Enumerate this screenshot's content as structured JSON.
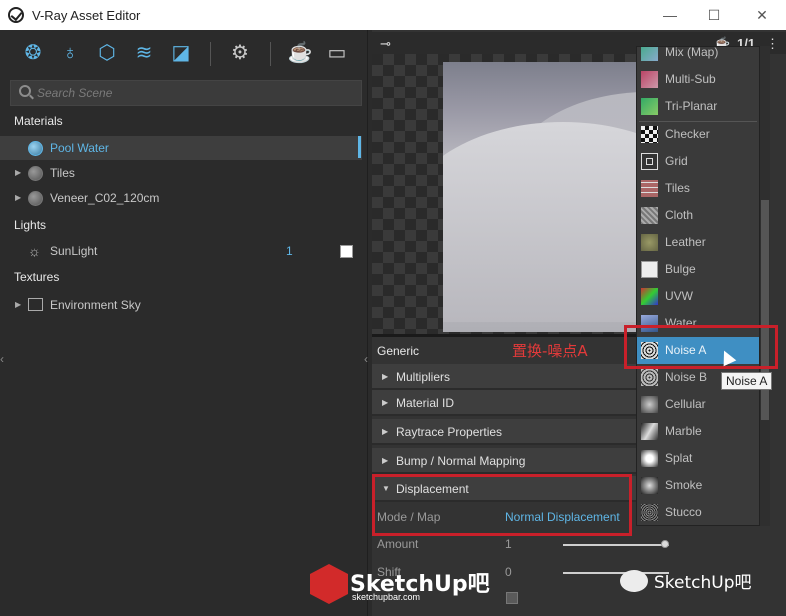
{
  "window": {
    "title": "V-Ray Asset Editor",
    "controls": [
      "—",
      "☐",
      "✕"
    ]
  },
  "toolbar": {
    "icons": [
      "materials-icon",
      "lights-icon",
      "geometry-icon",
      "textures-icon",
      "render-elements-icon",
      "settings-icon",
      "interactive-render-icon",
      "frame-buffer-icon"
    ]
  },
  "search": {
    "placeholder": "Search Scene"
  },
  "outliner": {
    "materials_label": "Materials",
    "materials": [
      {
        "label": "Pool Water",
        "selected": true
      },
      {
        "label": "Tiles"
      },
      {
        "label": "Veneer_C02_120cm"
      }
    ],
    "lights_label": "Lights",
    "lights": [
      {
        "label": "SunLight",
        "value": "1"
      }
    ],
    "textures_label": "Textures",
    "textures": [
      {
        "label": "Environment Sky"
      }
    ]
  },
  "preview": {
    "counter": "1/1"
  },
  "properties": {
    "generic_label": "Generic",
    "sections": [
      "Multipliers",
      "Material ID",
      "Raytrace Properties",
      "Bump / Normal Mapping",
      "Displacement"
    ],
    "mode_label": "Mode / Map",
    "mode_value": "Normal Displacement",
    "amount_label": "Amount",
    "amount_value": "1",
    "shift_label": "Shift",
    "shift_value": "0"
  },
  "annotation": "置换-噪点A",
  "menu": {
    "items": [
      "Mix (Map)",
      "Multi-Sub",
      "Tri-Planar",
      "Checker",
      "Grid",
      "Tiles",
      "Cloth",
      "Leather",
      "Bulge",
      "UVW",
      "Water",
      "Noise A",
      "Noise B",
      "Cellular",
      "Marble",
      "Splat",
      "Smoke",
      "Stucco"
    ],
    "highlighted": "Noise A",
    "tooltip": "Noise A"
  },
  "watermark": {
    "brand": "SketchUp吧",
    "url": "sketchupbar.com",
    "wechat": "SketchUp吧"
  },
  "colors": {
    "accent": "#5fb6e6",
    "highlight": "#3f8fc3",
    "annotation": "#c9202a"
  }
}
